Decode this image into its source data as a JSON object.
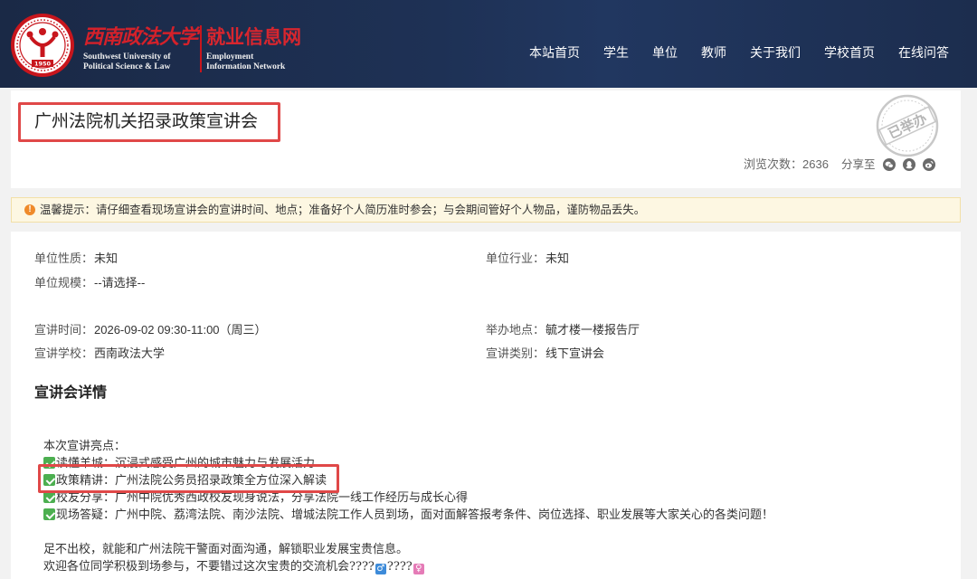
{
  "header": {
    "logo": {
      "year": "1950"
    },
    "site_name_cn": "西南政法大学",
    "site_sub_cn": "就业信息网",
    "site_name_en_1": "Southwest University of",
    "site_name_en_2": "Political Science & Law",
    "site_sub_en_1": "Employment",
    "site_sub_en_2": "Information Network",
    "nav": [
      {
        "label": "本站首页"
      },
      {
        "label": "学生"
      },
      {
        "label": "单位"
      },
      {
        "label": "教师"
      },
      {
        "label": "关于我们"
      },
      {
        "label": "学校首页"
      },
      {
        "label": "在线问答"
      }
    ]
  },
  "event": {
    "title": "广州法院机关招录政策宣讲会",
    "stamp": "已举办",
    "views_label": "浏览次数：",
    "views_count": "2636",
    "share_label": "分享至",
    "share_icons": [
      "wechat-icon",
      "qq-icon",
      "weibo-icon"
    ]
  },
  "notice": {
    "icon": "warning-icon",
    "text": "温馨提示：请仔细查看现场宣讲会的宣讲时间、地点；准备好个人简历准时参会；与会期间管好个人物品，谨防物品丢失。"
  },
  "info": {
    "unit_nature": {
      "label": "单位性质：",
      "value": "未知"
    },
    "unit_industry": {
      "label": "单位行业：",
      "value": "未知"
    },
    "unit_scale": {
      "label": "单位规模：",
      "value": "--请选择--"
    },
    "talk_time": {
      "label": "宣讲时间：",
      "value": "2026-09-02 09:30-11:00（周三）"
    },
    "venue": {
      "label": "举办地点：",
      "value": "毓才楼一楼报告厅"
    },
    "school": {
      "label": "宣讲学校：",
      "value": "西南政法大学"
    },
    "category": {
      "label": "宣讲类别：",
      "value": "线下宣讲会"
    }
  },
  "details": {
    "heading": "宣讲会详情",
    "intro": "本次宣讲亮点：",
    "highlights": [
      "读懂羊城：沉浸式感受广州的城市魅力与发展活力",
      "政策精讲：广州法院公务员招录政策全方位深入解读",
      "校友分享：广州中院优秀西政校友现身说法，分享法院一线工作经历与成长心得",
      "现场答疑：广州中院、荔湾法院、南沙法院、增城法院工作人员到场，面对面解答报考条件、岗位选择、职业发展等大家关心的各类问题！"
    ],
    "closing_1": "足不出校，就能和广州法院干警面对面沟通，解锁职业发展宝贵信息。",
    "closing_2a": "欢迎各位同学积极到场参与，不要错过这次宝贵的交流机会????",
    "closing_2b": "????",
    "icons": [
      "check-box-icon",
      "male-sign-icon",
      "female-sign-icon"
    ]
  },
  "colors": {
    "header_bg": "#1e3155",
    "brand_red": "#c8161d",
    "notice_bg": "#fdf7e2",
    "warning_orange": "#ef8a2a",
    "annotation_red": "#e04848",
    "check_green": "#4caf50"
  }
}
